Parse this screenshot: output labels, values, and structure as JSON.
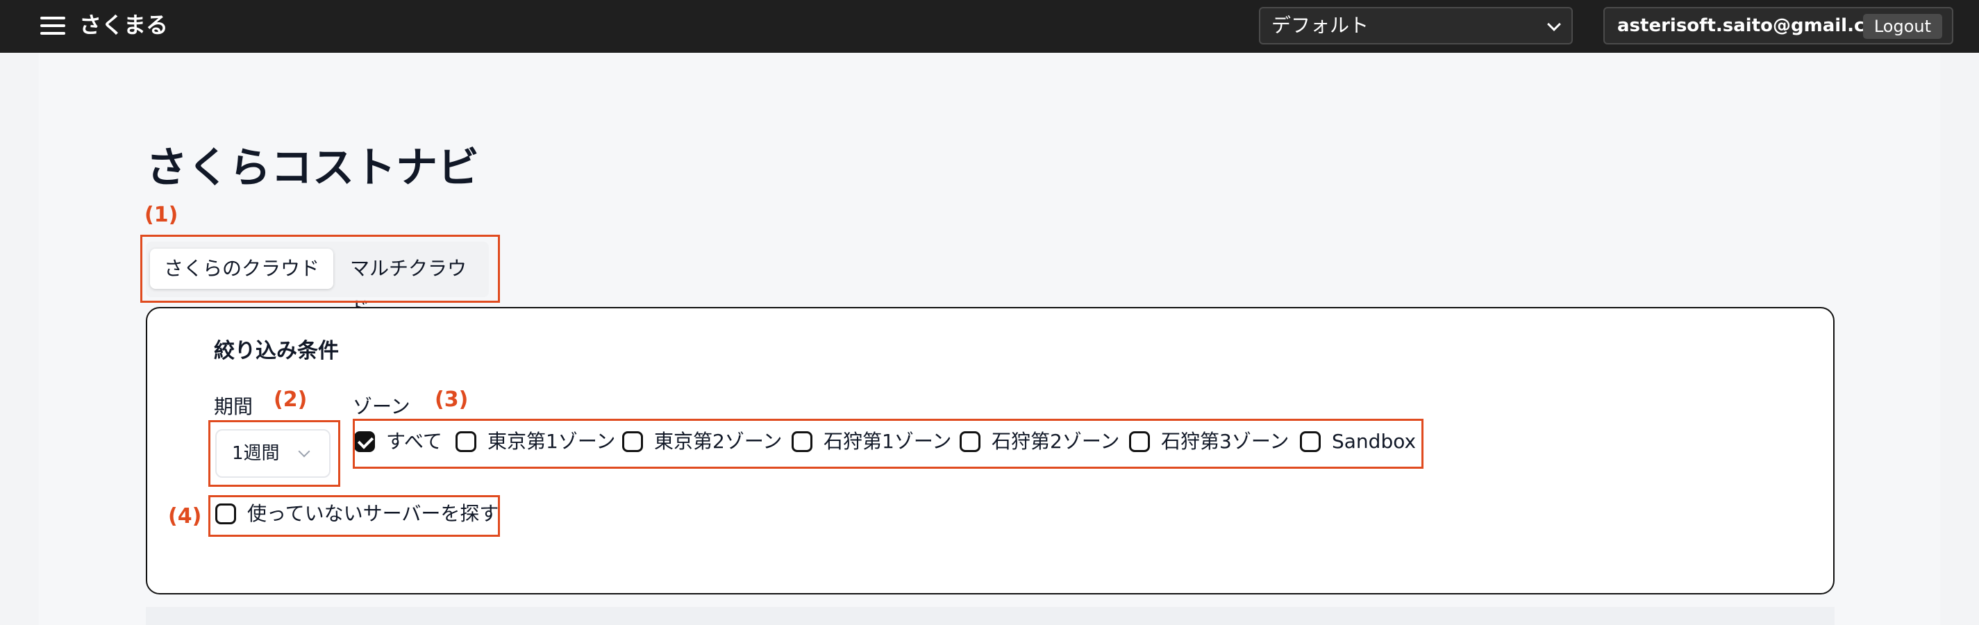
{
  "header": {
    "brand": "さくまる",
    "environment": "デフォルト",
    "user_email": "asterisoft.saito@gmail.com",
    "logout_label": "Logout"
  },
  "page": {
    "title": "さくらコストナビ"
  },
  "annotations": [
    "(1)",
    "(2)",
    "(3)",
    "(4)"
  ],
  "tabs": [
    {
      "label": "さくらのクラウド",
      "active": true
    },
    {
      "label": "マルチクラウド",
      "active": false
    }
  ],
  "filters": {
    "title": "絞り込み条件",
    "period_label": "期間",
    "period_value": "1週間",
    "zone_label": "ゾーン",
    "zones": [
      {
        "label": "すべて",
        "checked": true
      },
      {
        "label": "東京第1ゾーン",
        "checked": false
      },
      {
        "label": "東京第2ゾーン",
        "checked": false
      },
      {
        "label": "石狩第1ゾーン",
        "checked": false
      },
      {
        "label": "石狩第2ゾーン",
        "checked": false
      },
      {
        "label": "石狩第3ゾーン",
        "checked": false
      },
      {
        "label": "Sandbox",
        "checked": false
      }
    ],
    "unused_servers_label": "使っていないサーバーを探す",
    "unused_servers_checked": false
  },
  "colors": {
    "annotation": "#e04b1f",
    "topbar": "#1f1f1f"
  }
}
